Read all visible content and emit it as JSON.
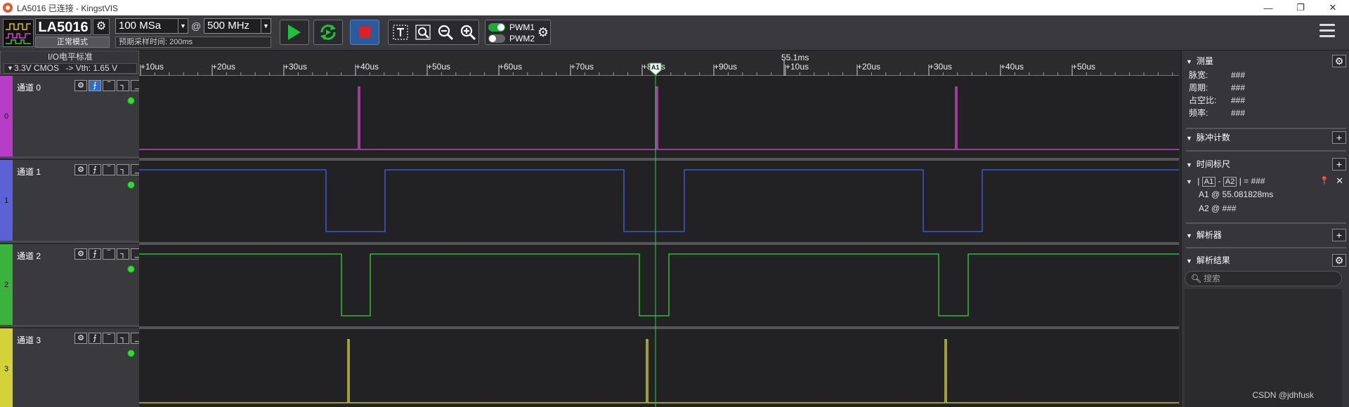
{
  "window": {
    "title": "LA5016 已连接 - KingstVIS",
    "controls": [
      "—",
      "❐",
      "✕"
    ]
  },
  "device": {
    "name": "LA5016",
    "mode": "正常模式"
  },
  "sampling": {
    "count": "100 MSa",
    "at": "@",
    "rate": "500 MHz",
    "time_label": "预期采样时间: 200ms"
  },
  "pwm": {
    "pwm1_label": "PWM1",
    "pwm2_label": "PWM2",
    "pwm1_on": true,
    "pwm2_on": false
  },
  "io_standard": {
    "label": "I/O电平标准",
    "value": "3.3V CMOS",
    "vth": "-> Vth: 1.65 V"
  },
  "channels": [
    {
      "index": "0",
      "name": "通道 0",
      "color": "#d94fd8",
      "strip": "#b63ec6"
    },
    {
      "index": "1",
      "name": "通道 1",
      "color": "#4a5ee8",
      "strip": "#5c62d6"
    },
    {
      "index": "2",
      "name": "通道 2",
      "color": "#35d13d",
      "strip": "#3ab23d"
    },
    {
      "index": "3",
      "name": "通道 3",
      "color": "#e8e33a",
      "strip": "#d4d23a"
    }
  ],
  "timeline": {
    "center_label": "55.1ms",
    "ticks": [
      "+10us",
      "+20us",
      "+30us",
      "+40us",
      "+50us",
      "+60us",
      "+70us",
      "+80us",
      "+90us",
      "+10us",
      "+20us",
      "+30us",
      "+40us",
      "+50us"
    ],
    "marker_label": "A1"
  },
  "panel": {
    "measure": {
      "title": "测量",
      "rows": [
        {
          "key": "脉宽:",
          "value": "###"
        },
        {
          "key": "周期:",
          "value": "###"
        },
        {
          "key": "占空比:",
          "value": "###"
        },
        {
          "key": "频率:",
          "value": "###"
        }
      ]
    },
    "pulse_count": {
      "title": "脉冲计数"
    },
    "time_ruler": {
      "title": "时间标尺",
      "a1_tag": "A1",
      "a2_tag": "A2",
      "diff_value": "###",
      "a1_line": "A1 @ 55.081828ms",
      "a2_line": "A2 @ ###"
    },
    "decoder": {
      "title": "解析器"
    },
    "results": {
      "title": "解析结果",
      "search_placeholder": "搜索"
    }
  },
  "watermark": "CSDN @jdhfusk"
}
